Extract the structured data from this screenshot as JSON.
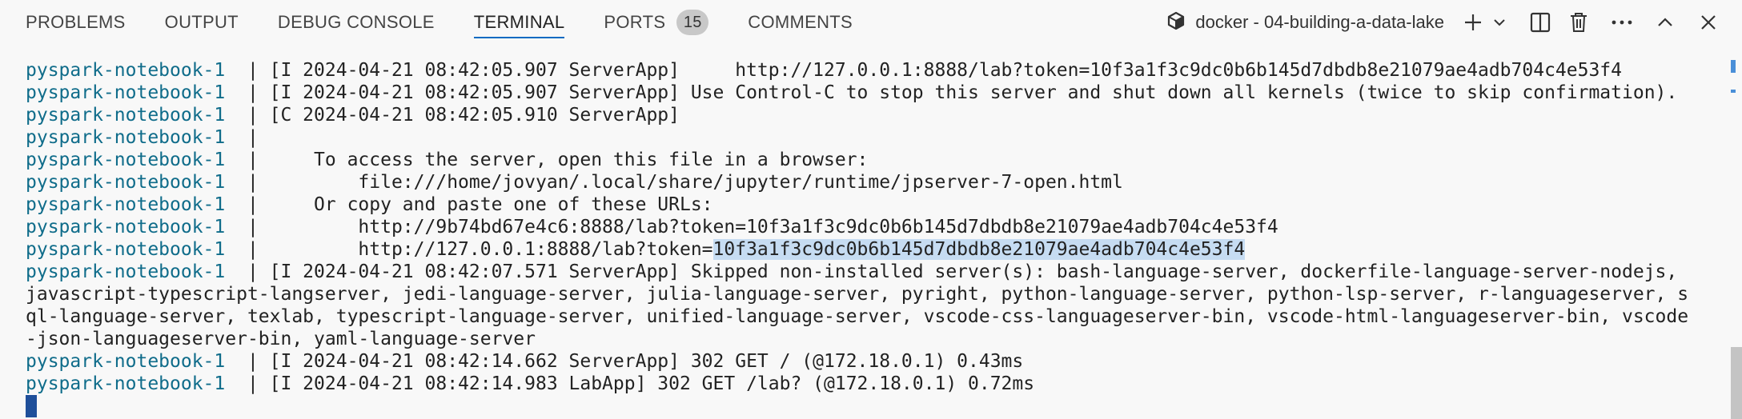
{
  "tabs": [
    {
      "label": "PROBLEMS"
    },
    {
      "label": "OUTPUT"
    },
    {
      "label": "DEBUG CONSOLE"
    },
    {
      "label": "TERMINAL",
      "active": true
    },
    {
      "label": "PORTS",
      "badge": "15"
    },
    {
      "label": "COMMENTS"
    }
  ],
  "terminal_selector": {
    "label": "docker - 04-building-a-data-lake",
    "icon": "docker-terminal-icon"
  },
  "actions": {
    "icons": [
      "plus-icon",
      "chevron-down-icon",
      "split-icon",
      "trash-icon",
      "more-icon",
      "chevron-up-icon",
      "close-icon"
    ]
  },
  "terminal": {
    "service": "pyspark-notebook-1",
    "sep": "  | ",
    "lines": [
      {
        "svc": true,
        "text": "[I 2024-04-21 08:42:05.907 ServerApp]     http://127.0.0.1:8888/lab?token=10f3a1f3c9dc0b6b145d7dbdb8e21079ae4adb704c4e53f4"
      },
      {
        "svc": true,
        "text": "[I 2024-04-21 08:42:05.907 ServerApp] Use Control-C to stop this server and shut down all kernels (twice to skip confirmation)."
      },
      {
        "svc": true,
        "text": "[C 2024-04-21 08:42:05.910 ServerApp]"
      },
      {
        "svc": true,
        "text": ""
      },
      {
        "svc": true,
        "text": "    To access the server, open this file in a browser:"
      },
      {
        "svc": true,
        "text": "        file:///home/jovyan/.local/share/jupyter/runtime/jpserver-7-open.html"
      },
      {
        "svc": true,
        "text": "    Or copy and paste one of these URLs:"
      },
      {
        "svc": true,
        "text": "        http://9b74bd67e4c6:8888/lab?token=10f3a1f3c9dc0b6b145d7dbdb8e21079ae4adb704c4e53f4"
      },
      {
        "svc": true,
        "text": "        http://127.0.0.1:8888/lab?token=",
        "highlight": "10f3a1f3c9dc0b6b145d7dbdb8e21079ae4adb704c4e53f4"
      },
      {
        "svc": true,
        "text": "[I 2024-04-21 08:42:07.571 ServerApp] Skipped non-installed server(s): bash-language-server, dockerfile-language-server-nodejs,"
      },
      {
        "svc": false,
        "text": "javascript-typescript-langserver, jedi-language-server, julia-language-server, pyright, python-language-server, python-lsp-server, r-languageserver, s"
      },
      {
        "svc": false,
        "text": "ql-language-server, texlab, typescript-language-server, unified-language-server, vscode-css-languageserver-bin, vscode-html-languageserver-bin, vscode"
      },
      {
        "svc": false,
        "text": "-json-languageserver-bin, yaml-language-server"
      },
      {
        "svc": true,
        "text": "[I 2024-04-21 08:42:14.662 ServerApp] 302 GET / (@172.18.0.1) 0.43ms"
      },
      {
        "svc": true,
        "text": "[I 2024-04-21 08:42:14.983 LabApp] 302 GET /lab? (@172.18.0.1) 0.72ms"
      }
    ]
  }
}
